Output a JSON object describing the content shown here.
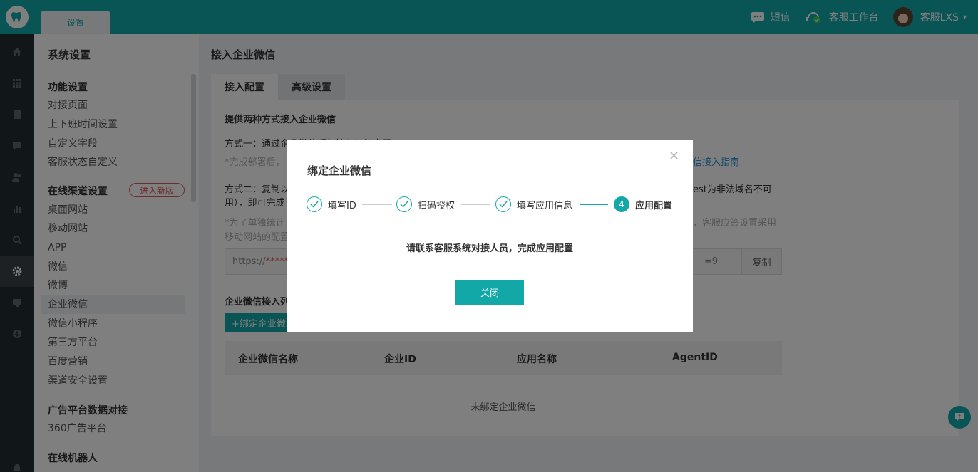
{
  "topbar": {
    "tab_label": "设置",
    "sms_label": "短信",
    "workbench_label": "客服工作台",
    "user_label": "客服LXS"
  },
  "rail": {
    "icons": [
      "home-icon",
      "grid-icon",
      "document-icon",
      "chat-icon",
      "users-icon",
      "chart-icon",
      "search-icon",
      "settings-icon",
      "monitor-icon",
      "download-icon",
      "bell-icon"
    ],
    "active": "settings-icon"
  },
  "sidebar": {
    "title": "系统设置",
    "groups": [
      {
        "label": "功能设置",
        "items": [
          "对接页面",
          "上下班时间设置",
          "自定义字段",
          "客服状态自定义"
        ]
      },
      {
        "label": "在线渠道设置",
        "badge": "进入新版",
        "items": [
          "桌面网站",
          "移动网站",
          "APP",
          "微信",
          "微博",
          "企业微信",
          "微信小程序",
          "第三方平台",
          "百度营销",
          "渠道安全设置"
        ]
      },
      {
        "label": "广告平台数据对接",
        "items": [
          "360广告平台"
        ]
      },
      {
        "label": "在线机器人",
        "items": []
      }
    ],
    "active_item": "企业微信"
  },
  "main": {
    "title": "接入企业微信",
    "tabs": [
      "接入配置",
      "高级设置"
    ],
    "intro_heading": "提供两种方式接入企业微信",
    "method1": "方式一：通过企业微信授权接入智能客服",
    "method1_note": "*完成部署后，",
    "guide_link": "信接入指南",
    "method2": "方式二：复制以",
    "method2_tail": "est为非法域名不可",
    "method2_line2": "用），即可完成",
    "note2": "*为了单独统计",
    "note2_tail": "，客服应答设置采用",
    "note2_line2": "移动网站的配置",
    "url_prefix": "https://",
    "url_masked": "*****",
    "url_suffix": "=9",
    "copy_label": "复制",
    "list_heading": "企业微信接入列",
    "bind_label": "+绑定企业微",
    "table_headers": [
      "企业微信名称",
      "企业ID",
      "应用名称",
      "AgentID"
    ],
    "empty_text": "未绑定企业微信"
  },
  "modal": {
    "title": "绑定企业微信",
    "steps": [
      "填写ID",
      "扫码授权",
      "填写应用信息",
      "应用配置"
    ],
    "current_step_number": "4",
    "message": "请联系客服系统对接人员，完成应用配置",
    "close_label": "关闭"
  },
  "colors": {
    "accent": "#13a8a8",
    "rail": "#222d32",
    "badge": "#e25a5a"
  }
}
